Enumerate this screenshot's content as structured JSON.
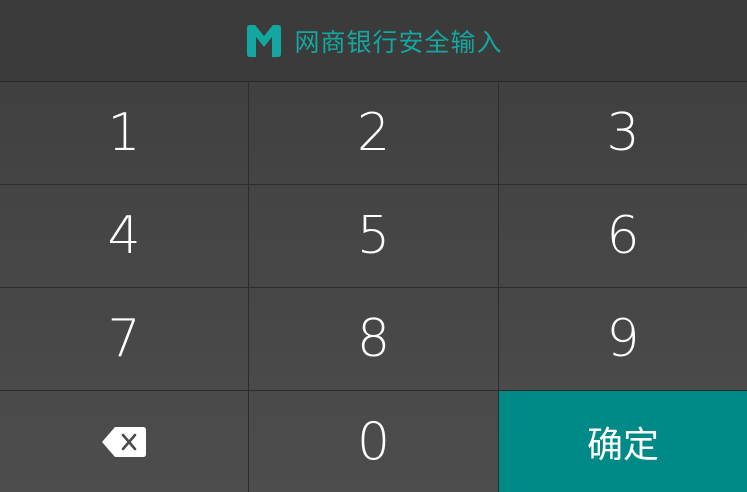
{
  "header": {
    "title": "网商银行安全输入",
    "logo_icon": "mybank-m-logo-icon",
    "accent_color": "#14a7a0"
  },
  "keypad": {
    "keys": [
      "1",
      "2",
      "3",
      "4",
      "5",
      "6",
      "7",
      "8",
      "9"
    ],
    "zero": "0",
    "delete_icon": "backspace-icon",
    "confirm_label": "确定",
    "confirm_color": "#008a87"
  }
}
